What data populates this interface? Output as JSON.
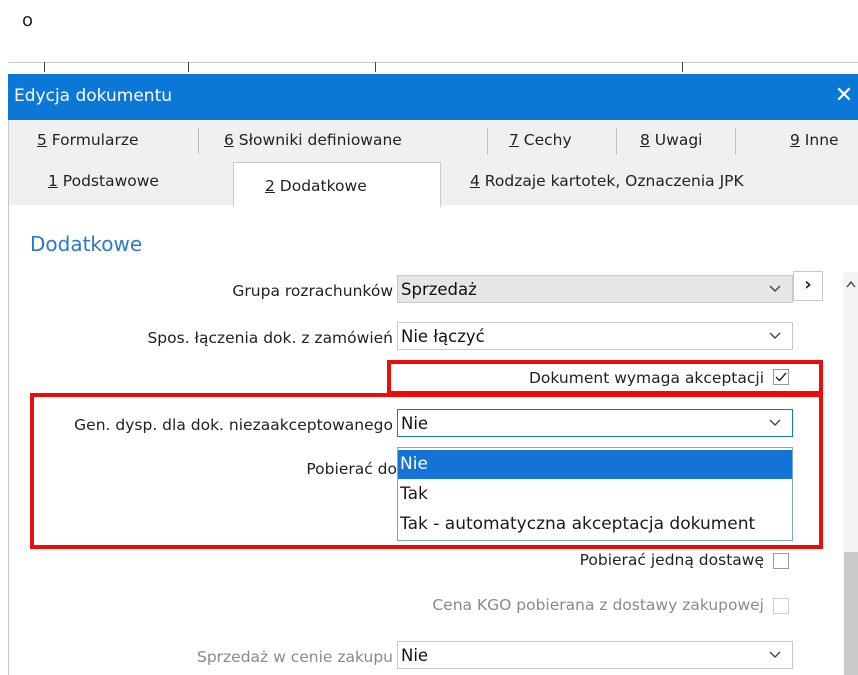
{
  "top_glyph": "o",
  "window": {
    "title": "Edycja dokumentu",
    "close_symbol": "✕"
  },
  "tabs": {
    "row1": [
      {
        "key": "5",
        "label": " Formularze"
      },
      {
        "key": "6",
        "label": " Słowniki definiowane"
      },
      {
        "key": "7",
        "label": " Cechy"
      },
      {
        "key": "8",
        "label": " Uwagi"
      },
      {
        "key": "9",
        "label": " Inne"
      }
    ],
    "row2": [
      {
        "key": "1",
        "label": " Podstawowe"
      },
      {
        "key": "2",
        "label": " Dodatkowe"
      },
      {
        "key": "4",
        "label": " Rodzaje kartotek, Oznaczenia JPK"
      }
    ],
    "active": "2 Dodatkowe"
  },
  "section": {
    "title": "Dodatkowe"
  },
  "form": {
    "grupa_label": "Grupa rozrachunków",
    "grupa_value": "Sprzedaż",
    "grupa_nav": "›",
    "spos_label": "Spos. łączenia dok. z zamówień",
    "spos_value": "Nie łączyć",
    "akceptacja_label": "Dokument wymaga akceptacji",
    "akceptacja_checked": true,
    "gen_label": "Gen. dysp. dla dok. niezaakceptowanego",
    "gen_value": "Nie",
    "pobierac_label_partial": "Pobierać do",
    "pobierac_jedna_label": "Pobierać jedną dostawę",
    "pobierac_jedna_checked": false,
    "cena_kgo_label": "Cena KGO pobierana z dostawy zakupowej",
    "cena_kgo_checked": false,
    "sprzedaz_label": "Sprzedaż w cenie zakupu",
    "sprzedaz_value": "Nie"
  },
  "dropdown": {
    "options": [
      "Nie",
      "Tak",
      "Tak - automatyczna akceptacja dokument"
    ],
    "selected_index": 0
  },
  "colors": {
    "titlebar": "#0b78d7",
    "highlight": "#ee0b0b",
    "selected_option": "#1373d6",
    "section_title": "#2b7ac9"
  }
}
